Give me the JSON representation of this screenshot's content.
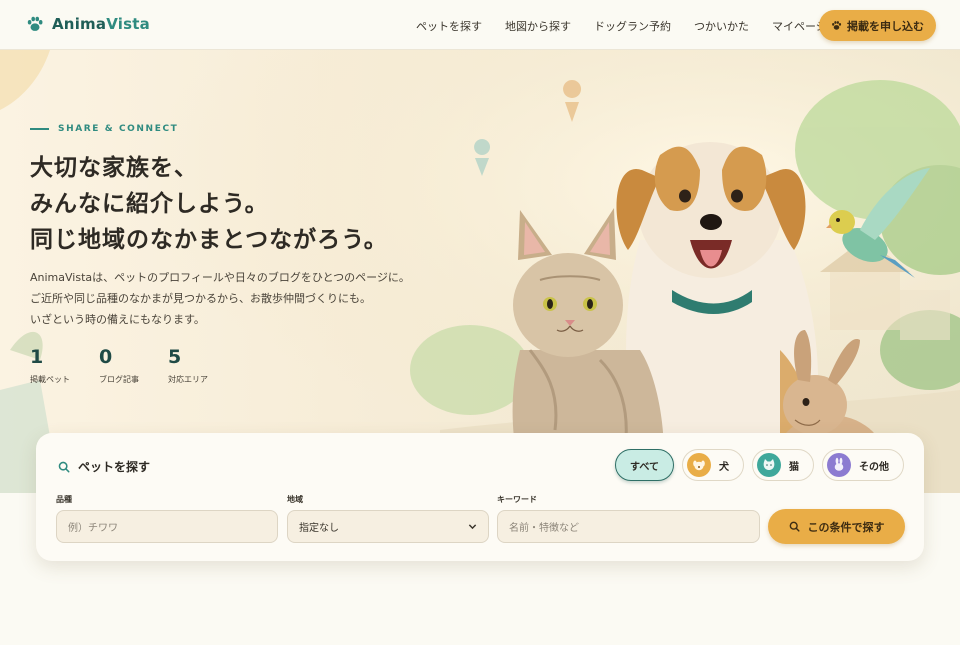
{
  "brand": {
    "name_part1": "Anima",
    "name_part2": "Vista",
    "icon": "paw-icon"
  },
  "nav": {
    "items": [
      "ペットを探す",
      "地図から探す",
      "ドッグラン予約",
      "つかいかた",
      "マイページ"
    ],
    "cta_label": "掲載を申し込む",
    "cta_icon": "paw-icon"
  },
  "hero": {
    "eyebrow": "SHARE & CONNECT",
    "headline": [
      "大切な家族を、",
      "みんなに紹介しよう。",
      "同じ地域のなかまとつながろう。"
    ],
    "description": [
      "AnimaVistaは、ペットのプロフィールや日々のブログをひとつのページに。",
      "ご近所や同じ品種のなかまが見つかるから、お散歩仲間づくりにも。",
      "いざという時の備えにもなります。"
    ],
    "stats": [
      {
        "value": "1",
        "label": "掲載ペット"
      },
      {
        "value": "0",
        "label": "ブログ記事"
      },
      {
        "value": "5",
        "label": "対応エリア"
      }
    ]
  },
  "search": {
    "title": "ペットを探す",
    "title_icon": "search-icon",
    "filters": [
      {
        "label": "すべて",
        "active": true
      },
      {
        "label": "犬",
        "icon": "dog-icon",
        "color": "#e9ad47"
      },
      {
        "label": "猫",
        "icon": "cat-icon",
        "color": "#3fa89b"
      },
      {
        "label": "その他",
        "icon": "rabbit-icon",
        "color": "#8c7bd1"
      }
    ],
    "breed_label": "品種",
    "breed_placeholder": "例）チワワ",
    "region_label": "地域",
    "region_value": "指定なし",
    "keyword_label": "キーワード",
    "keyword_placeholder": "名前・特徴など",
    "submit_label": "この条件で探す"
  },
  "colors": {
    "accent": "#e9ad47",
    "teal": "#2f8b80",
    "dark_teal": "#1f5e57",
    "background": "#fbfaf3"
  }
}
